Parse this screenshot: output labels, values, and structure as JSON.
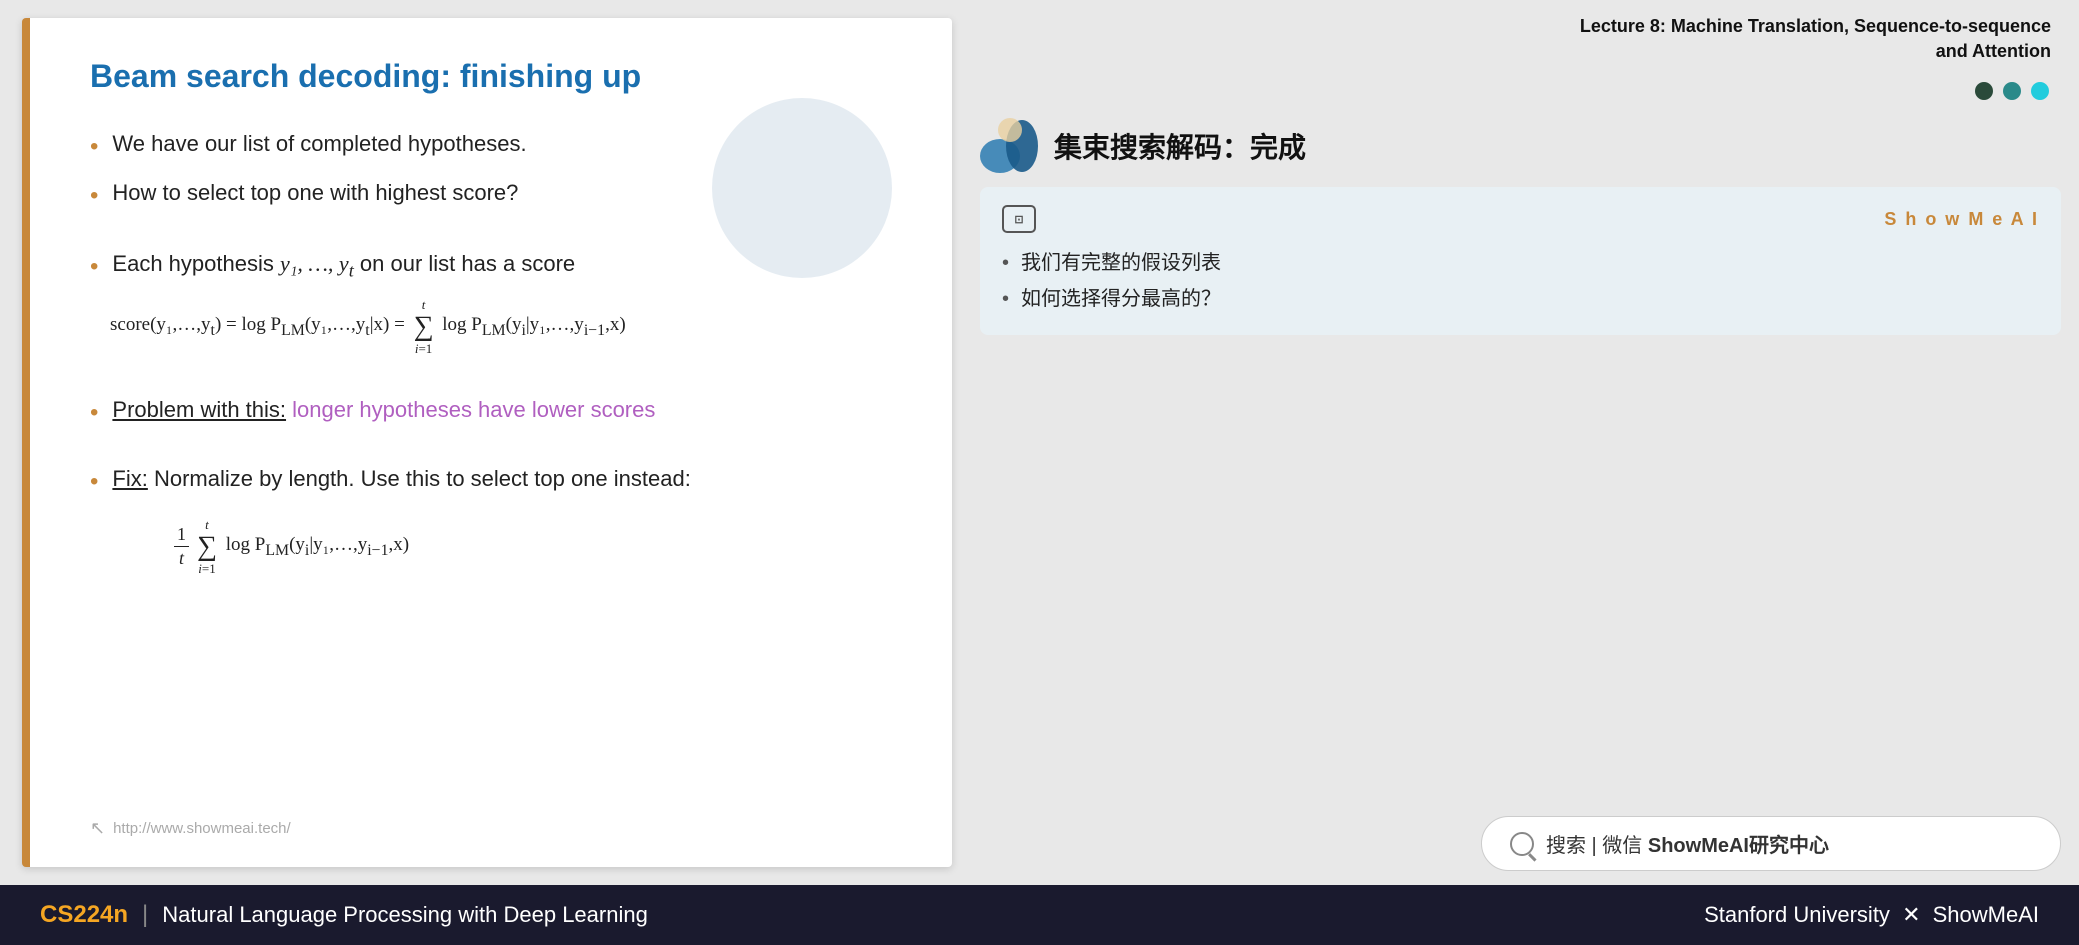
{
  "slide": {
    "title": "Beam search decoding: finishing up",
    "bullets": [
      "We have our list of completed hypotheses.",
      "How to select top one with highest score?"
    ],
    "bullet3": "Each hypothesis",
    "math_vars": "y₁, …, yₜ",
    "bullet3_end": "on our list has a score",
    "score_eq_left": "score(y₁,…,yₜ) = log P",
    "score_eq_lm": "LM",
    "problem_label": "Problem with this:",
    "problem_text": "longer hypotheses have lower scores",
    "fix_label": "Fix:",
    "fix_text": "Normalize by length. Use this to select top one instead:",
    "url": "http://www.showmeai.tech/"
  },
  "right_panel": {
    "lecture_line1": "Lecture 8:  Machine Translation, Sequence-to-sequence",
    "lecture_line2": "and Attention",
    "chinese_title": "集束搜索解码：完成",
    "dots": [
      "dark",
      "teal",
      "cyan"
    ],
    "translation_box": {
      "ai_icon": "⊡",
      "brand": "S h o w M e A I",
      "bullets": [
        "我们有完整的假设列表",
        "如何选择得分最高的？"
      ]
    },
    "search_text": "搜索 | 微信 ShowMeAI研究中心"
  },
  "footer": {
    "cs_label": "CS224n",
    "divider": "|",
    "course_name": "Natural Language Processing with Deep Learning",
    "right_text": "Stanford University  ✕  ShowMeAI"
  }
}
